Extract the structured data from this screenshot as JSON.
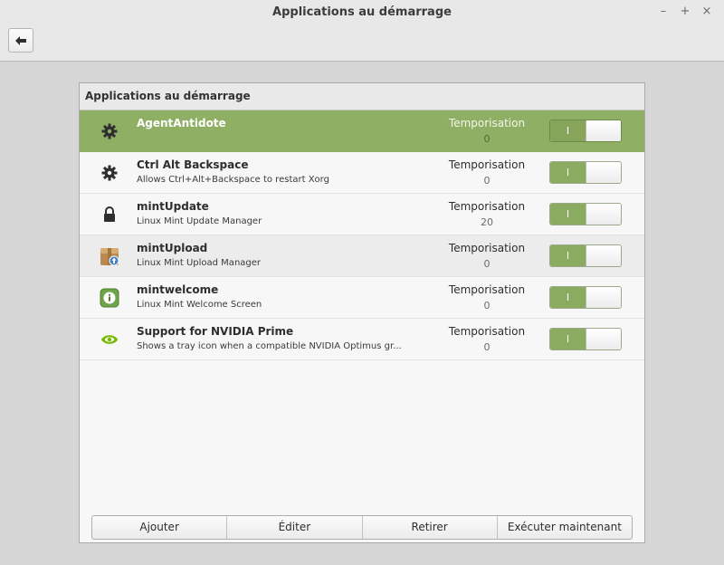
{
  "window": {
    "title": "Applications au démarrage",
    "controls": [
      "–",
      "+",
      "×"
    ]
  },
  "panel": {
    "header": "Applications au démarrage"
  },
  "items": [
    {
      "name": "AgentAntidote",
      "desc": "",
      "delay_label": "Temporisation",
      "delay": "0",
      "enabled": true,
      "icon": "gear-icon",
      "selected": true
    },
    {
      "name": "Ctrl Alt Backspace",
      "desc": "Allows Ctrl+Alt+Backspace to restart Xorg",
      "delay_label": "Temporisation",
      "delay": "0",
      "enabled": true,
      "icon": "gear-icon"
    },
    {
      "name": "mintUpdate",
      "desc": "Linux Mint Update Manager",
      "delay_label": "Temporisation",
      "delay": "20",
      "enabled": true,
      "icon": "lock-icon"
    },
    {
      "name": "mintUpload",
      "desc": "Linux Mint Upload Manager",
      "delay_label": "Temporisation",
      "delay": "0",
      "enabled": true,
      "icon": "upload-box-icon"
    },
    {
      "name": "mintwelcome",
      "desc": "Linux Mint Welcome Screen",
      "delay_label": "Temporisation",
      "delay": "0",
      "enabled": true,
      "icon": "info-icon"
    },
    {
      "name": "Support for NVIDIA Prime",
      "desc": "Shows a tray icon when a compatible NVIDIA Optimus gr...",
      "delay_label": "Temporisation",
      "delay": "0",
      "enabled": true,
      "icon": "nvidia-icon"
    }
  ],
  "switch_on_label": "I",
  "toolbar": {
    "add": "Ajouter",
    "edit": "Éditer",
    "remove": "Retirer",
    "run_now": "Exécuter maintenant"
  },
  "colors": {
    "accent": "#8fb064",
    "switch_on": "#8bab60"
  }
}
